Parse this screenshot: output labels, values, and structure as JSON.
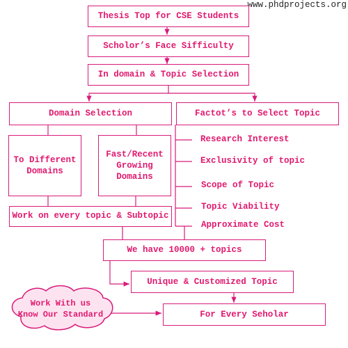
{
  "website": "www.phdprojects.org",
  "colors": {
    "accent": "#e0196f",
    "line": "#d81b7a",
    "cloud_fill": "#fde3f0"
  },
  "flow": {
    "title": "Thesis Top for CSE Students",
    "step2": "Scholor’s Face Sifficulty",
    "step3": "In domain & Topic Selection",
    "domain_selection": "Domain Selection",
    "factors": "Factot’s to Select Topic",
    "different_domains": "To Different Domains",
    "recent_domains": "Fast/Recent Growing Domains",
    "work_every_topic": "Work on every topic & Subtopic",
    "factor_items": [
      "Research Interest",
      "Exclusivity of topic",
      "Scope of Topic",
      "Topic Viability",
      "Approximate Cost"
    ],
    "topics_count": "We have 10000 + topics",
    "unique_topic": "Unique & Customized Topic",
    "every_scholar": "For Every Seholar",
    "cloud_line1": "Work With us",
    "cloud_line2": "Know Our Standard"
  }
}
